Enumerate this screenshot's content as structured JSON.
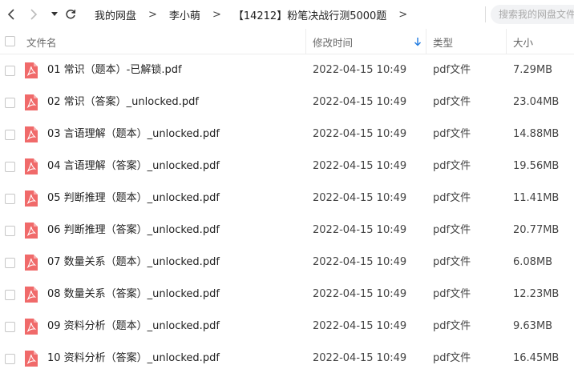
{
  "toolbar": {
    "back_icon": "chevron-left-icon",
    "forward_icon": "chevron-right-icon",
    "dropdown_icon": "caret-down-icon",
    "refresh_icon": "refresh-icon",
    "breadcrumbs": [
      "我的网盘",
      "李小萌",
      "【14212】粉笔决战行测5000题"
    ],
    "separator": ">",
    "search_placeholder": "搜索我的网盘文件"
  },
  "table": {
    "headers": {
      "name": "文件名",
      "modified": "修改时间",
      "type": "类型",
      "size": "大小"
    },
    "sort": {
      "column": "modified",
      "direction": "desc",
      "color": "#1f7ae0"
    },
    "rows": [
      {
        "name": "01 常识（题本）-已解锁.pdf",
        "modified": "2022-04-15 10:49",
        "type": "pdf文件",
        "size": "7.29MB"
      },
      {
        "name": "02 常识（答案）_unlocked.pdf",
        "modified": "2022-04-15 10:49",
        "type": "pdf文件",
        "size": "23.04MB"
      },
      {
        "name": "03 言语理解（题本）_unlocked.pdf",
        "modified": "2022-04-15 10:49",
        "type": "pdf文件",
        "size": "14.88MB"
      },
      {
        "name": "04 言语理解（答案）_unlocked.pdf",
        "modified": "2022-04-15 10:49",
        "type": "pdf文件",
        "size": "19.56MB"
      },
      {
        "name": "05 判断推理（题本）_unlocked.pdf",
        "modified": "2022-04-15 10:49",
        "type": "pdf文件",
        "size": "11.41MB"
      },
      {
        "name": "06 判断推理（答案）_unlocked.pdf",
        "modified": "2022-04-15 10:49",
        "type": "pdf文件",
        "size": "20.77MB"
      },
      {
        "name": "07 数量关系（题本）_unlocked.pdf",
        "modified": "2022-04-15 10:49",
        "type": "pdf文件",
        "size": "6.08MB"
      },
      {
        "name": "08 数量关系（答案）_unlocked.pdf",
        "modified": "2022-04-15 10:49",
        "type": "pdf文件",
        "size": "12.23MB"
      },
      {
        "name": "09 资料分析（题本）_unlocked.pdf",
        "modified": "2022-04-15 10:49",
        "type": "pdf文件",
        "size": "9.63MB"
      },
      {
        "name": "10 资料分析（答案）_unlocked.pdf",
        "modified": "2022-04-15 10:49",
        "type": "pdf文件",
        "size": "16.45MB"
      }
    ],
    "file_icon": "pdf-file-icon",
    "pdf_icon_color": "#f06a6a"
  }
}
